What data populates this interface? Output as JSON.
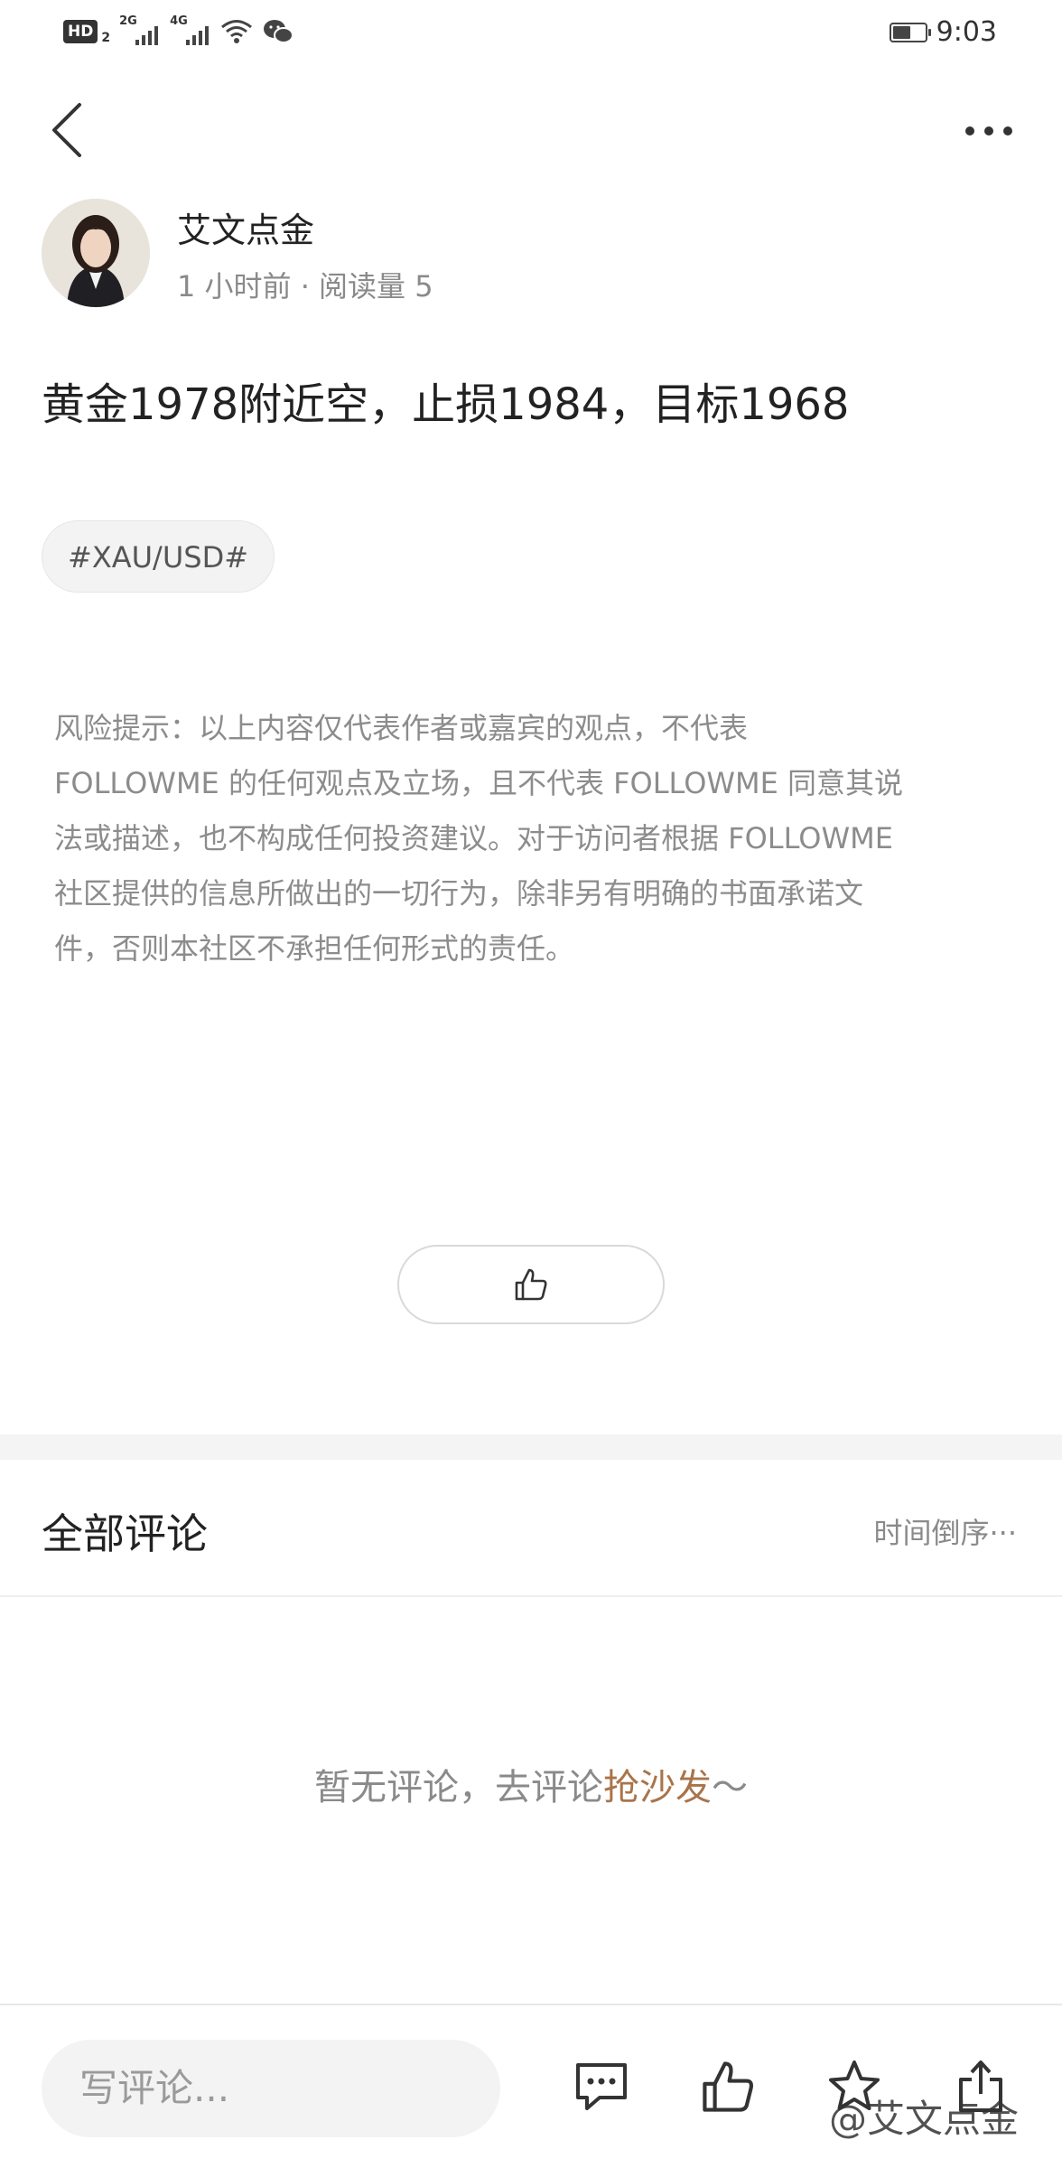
{
  "status_bar": {
    "hd_label": "HD",
    "hd_sub": "2",
    "network_1": "2G",
    "network_2": "4G",
    "time": "9:03",
    "battery_level": 0.55,
    "icons": [
      "signal-icon",
      "wifi-icon",
      "wechat-icon",
      "battery-icon"
    ]
  },
  "nav": {
    "back_icon": "chevron-left-icon",
    "more_icon": "more-horizontal-icon"
  },
  "author": {
    "name": "艾文点金",
    "meta": "1 小时前 · 阅读量 5"
  },
  "post": {
    "text": "黄金1978附近空，止损1984，目标1968",
    "tag": "#XAU/USD#"
  },
  "disclaimer": {
    "lines": [
      "风险提示：以上内容仅代表作者或嘉宾的观点，不代表",
      "FOLLOWME 的任何观点及立场，且不代表 FOLLOWME 同意其说",
      "法或描述，也不构成任何投资建议。对于访问者根据 FOLLOWME",
      "社区提供的信息所做出的一切行为，除非另有明确的书面承诺文",
      "件，否则本社区不承担任何形式的责任。"
    ]
  },
  "comments": {
    "title": "全部评论",
    "sort_label": "时间倒序",
    "empty_prefix": "暂无评论，去评论",
    "empty_link": "抢沙发",
    "empty_suffix": "～"
  },
  "bottom_bar": {
    "input_placeholder": "写评论...",
    "icons": [
      "comment-icon",
      "thumbs-up-icon",
      "star-icon",
      "share-icon"
    ],
    "watermark": "@艾文点金"
  },
  "colors": {
    "accent_link": "#a9744a",
    "muted_text": "#8a8a8a",
    "divider": "#f4f4f4"
  }
}
